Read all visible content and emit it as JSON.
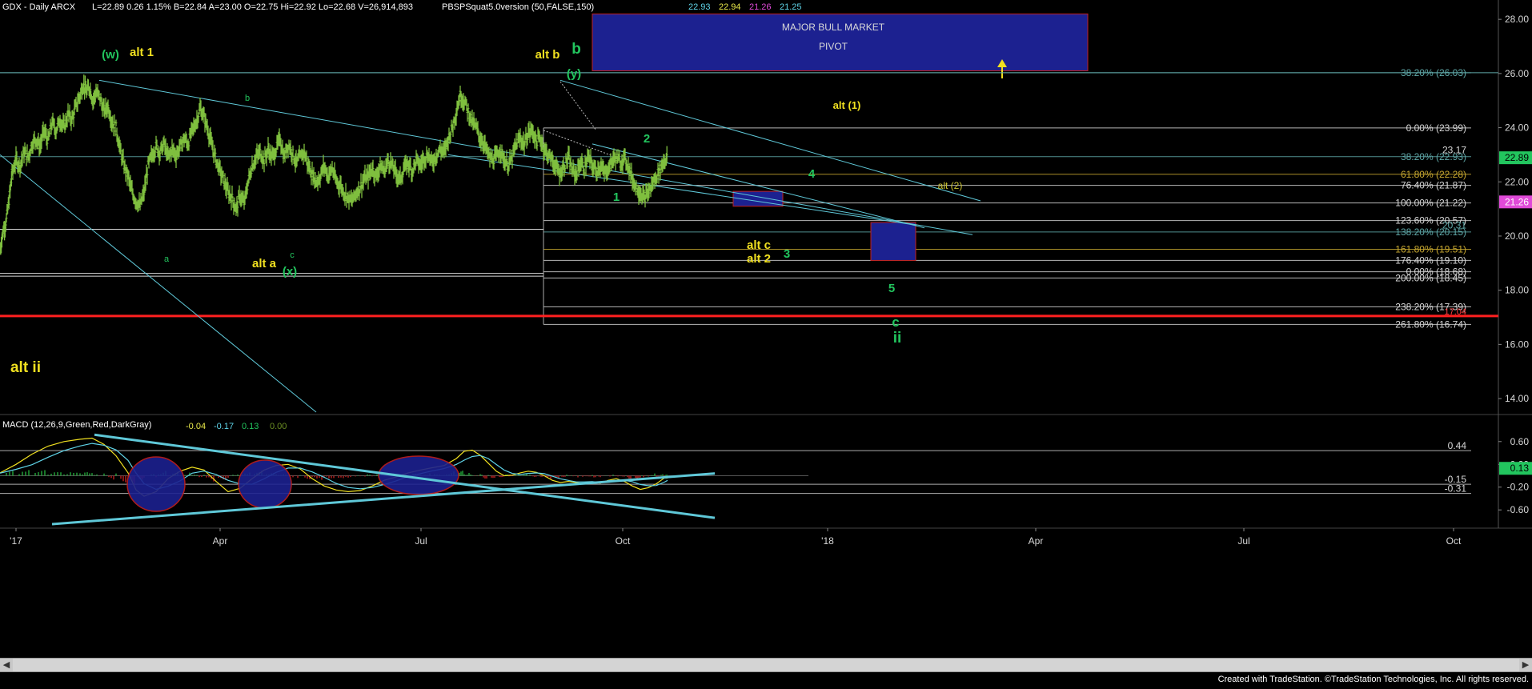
{
  "header": {
    "symbol_line": "GDX - Daily  ARCX",
    "quote": "L=22.89  0.26  1.15%  B=22.84  A=23.00  O=22.75  Hi=22.92  Lo=22.68  V=26,914,893",
    "study_name": "PBSPSquat5.0version (50,FALSE,150)",
    "study_values": [
      {
        "text": "22.93",
        "color": "#5fd4e8"
      },
      {
        "text": "22.94",
        "color": "#e8e84a"
      },
      {
        "text": "21.26",
        "color": "#e04ad8"
      },
      {
        "text": "21.25",
        "color": "#5fd4e8"
      }
    ]
  },
  "macd_header": {
    "name": "MACD (12,26,9,Green,Red,DarkGray)",
    "values": [
      {
        "text": "-0.04",
        "color": "#e8e84a"
      },
      {
        "text": "-0.17",
        "color": "#5fd4e8"
      },
      {
        "text": "0.13",
        "color": "#22c55e"
      },
      {
        "text": "0.00",
        "color": "#6b8e23"
      }
    ]
  },
  "credit": "Created with TradeStation. ©TradeStation Technologies, Inc. All rights reserved.",
  "chart_data": {
    "type": "line",
    "price_axis": {
      "ticks": [
        "28.00",
        "26.00",
        "24.00",
        "22.00",
        "20.00",
        "18.00",
        "16.00",
        "14.00"
      ],
      "ylim": [
        13.5,
        28.3
      ]
    },
    "macd_axis": {
      "ticks": [
        "0.60",
        "0.20",
        "-0.20",
        "-0.60"
      ],
      "ylim": [
        -0.85,
        0.85
      ]
    },
    "x_ticks": [
      "'17",
      "Apr",
      "Jul",
      "Oct",
      "'18",
      "Apr",
      "Jul",
      "Oct"
    ],
    "last_price": {
      "text": "22.89",
      "value": 22.89,
      "color": "#22c55e"
    },
    "last_study": {
      "text": "21.26",
      "value": 21.26,
      "color": "#e04ad8"
    },
    "macd_last": {
      "text": "0.13",
      "value": 0.13,
      "color": "#22c55e"
    },
    "pivot_box": {
      "line1": "MAJOR BULL MARKET",
      "line2": "PIVOT",
      "y_low": 26.1,
      "y_high": 28.2
    },
    "red_support": 17.05,
    "red_support_label": "17.04",
    "fib_levels": [
      {
        "label": "38.20% (26.03)",
        "value": 26.03,
        "color": "#5fa8a8"
      },
      {
        "label": "0.00% (23.99)",
        "value": 23.99,
        "color": "#d8d8d8"
      },
      {
        "label": "38.20% (22.93)",
        "value": 22.93,
        "color": "#5fa8a8"
      },
      {
        "label": "61.80% (22.28)",
        "value": 22.28,
        "color": "#c8a830"
      },
      {
        "label": "76.40% (21.87)",
        "value": 21.87,
        "color": "#d8d8d8"
      },
      {
        "label": "100.00% (21.22)",
        "value": 21.22,
        "color": "#d8d8d8"
      },
      {
        "label": "123.60% (20.57)",
        "value": 20.57,
        "color": "#d8d8d8"
      },
      {
        "label": "138.20% (20.15)",
        "value": 20.15,
        "color": "#5fa8a8"
      },
      {
        "label": "161.80% (19.51)",
        "value": 19.51,
        "color": "#c8a830"
      },
      {
        "label": "176.40% (19.10)",
        "value": 19.1,
        "color": "#d8d8d8"
      },
      {
        "label": "0.00% (18.68)",
        "value": 18.68,
        "color": "#d8d8d8"
      },
      {
        "label": "200.00% (18.45)",
        "value": 18.45,
        "color": "#d8d8d8"
      },
      {
        "label": "238.20% (17.39)",
        "value": 17.39,
        "color": "#d8d8d8"
      },
      {
        "label": "261.80% (16.74)",
        "value": 16.74,
        "color": "#d8d8d8"
      }
    ],
    "extra_labels": [
      {
        "text": "23.17",
        "value": 23.17,
        "color": "#d8d8d8"
      },
      {
        "text": "20.31",
        "value": 20.4,
        "color": "#5fa8a8"
      }
    ],
    "macd_levels": [
      {
        "label": "0.44",
        "value": 0.44
      },
      {
        "label": "-0.15",
        "value": -0.15
      },
      {
        "label": "-0.31",
        "value": -0.31
      }
    ],
    "wave_labels": [
      {
        "text": "(w)",
        "color": "#22c55e",
        "size": 15,
        "bold": true
      },
      {
        "text": "alt 1",
        "color": "#f0e020",
        "size": 15,
        "bold": true
      },
      {
        "text": "b",
        "color": "#22c55e",
        "size": 11,
        "bold": false
      },
      {
        "text": "a",
        "color": "#22c55e",
        "size": 11,
        "bold": false
      },
      {
        "text": "c",
        "color": "#22c55e",
        "size": 11,
        "bold": false
      },
      {
        "text": "alt a",
        "color": "#f0e020",
        "size": 15,
        "bold": true
      },
      {
        "text": "(x)",
        "color": "#22c55e",
        "size": 15,
        "bold": true
      },
      {
        "text": "alt b",
        "color": "#f0e020",
        "size": 15,
        "bold": true
      },
      {
        "text": "b",
        "color": "#22c55e",
        "size": 19,
        "bold": true
      },
      {
        "text": "(y)",
        "color": "#22c55e",
        "size": 15,
        "bold": true
      },
      {
        "text": "alt (1)",
        "color": "#f0e020",
        "size": 13,
        "bold": true
      },
      {
        "text": "2",
        "color": "#22c55e",
        "size": 15,
        "bold": true
      },
      {
        "text": "1",
        "color": "#22c55e",
        "size": 15,
        "bold": true
      },
      {
        "text": "4",
        "color": "#22c55e",
        "size": 15,
        "bold": true
      },
      {
        "text": "3",
        "color": "#22c55e",
        "size": 15,
        "bold": true
      },
      {
        "text": "alt c",
        "color": "#f0e020",
        "size": 15,
        "bold": true
      },
      {
        "text": "alt 2",
        "color": "#f0e020",
        "size": 15,
        "bold": true
      },
      {
        "text": "alt (2)",
        "color": "#c8c030",
        "size": 12,
        "bold": false
      },
      {
        "text": "5",
        "color": "#22c55e",
        "size": 15,
        "bold": true
      },
      {
        "text": "c",
        "color": "#22c55e",
        "size": 17,
        "bold": true
      },
      {
        "text": "ii",
        "color": "#22c55e",
        "size": 19,
        "bold": true
      },
      {
        "text": "alt ii",
        "color": "#f0e020",
        "size": 19,
        "bold": true
      }
    ],
    "price_series": [
      [
        0,
        19.5
      ],
      [
        4,
        20.2
      ],
      [
        8,
        20.6
      ],
      [
        12,
        21.5
      ],
      [
        15,
        22.3
      ],
      [
        20,
        22.8
      ],
      [
        25,
        22.6
      ],
      [
        30,
        23.1
      ],
      [
        35,
        22.9
      ],
      [
        40,
        23.4
      ],
      [
        45,
        23.6
      ],
      [
        50,
        23.3
      ],
      [
        55,
        23.9
      ],
      [
        60,
        23.5
      ],
      [
        65,
        24.2
      ],
      [
        70,
        23.9
      ],
      [
        75,
        24.3
      ],
      [
        80,
        24.0
      ],
      [
        85,
        24.5
      ],
      [
        90,
        24.3
      ],
      [
        95,
        24.8
      ],
      [
        100,
        25.2
      ],
      [
        104,
        25.6
      ],
      [
        108,
        25.3
      ],
      [
        112,
        25.5
      ],
      [
        116,
        25.0
      ],
      [
        120,
        25.3
      ],
      [
        125,
        25.1
      ],
      [
        130,
        24.6
      ],
      [
        135,
        24.8
      ],
      [
        140,
        24.2
      ],
      [
        145,
        24.0
      ],
      [
        150,
        23.2
      ],
      [
        155,
        22.6
      ],
      [
        160,
        22.2
      ],
      [
        165,
        21.6
      ],
      [
        170,
        21.3
      ],
      [
        175,
        21.1
      ],
      [
        180,
        21.6
      ],
      [
        185,
        22.6
      ],
      [
        190,
        23.0
      ],
      [
        195,
        23.3
      ],
      [
        200,
        23.1
      ],
      [
        205,
        23.4
      ],
      [
        210,
        22.9
      ],
      [
        215,
        23.2
      ],
      [
        220,
        23.0
      ],
      [
        225,
        23.3
      ],
      [
        230,
        23.6
      ],
      [
        235,
        23.4
      ],
      [
        240,
        23.9
      ],
      [
        245,
        24.2
      ],
      [
        250,
        24.7
      ],
      [
        255,
        24.4
      ],
      [
        260,
        23.9
      ],
      [
        265,
        23.3
      ],
      [
        270,
        22.8
      ],
      [
        275,
        22.4
      ],
      [
        280,
        22.0
      ],
      [
        285,
        21.6
      ],
      [
        290,
        21.4
      ],
      [
        295,
        21.0
      ],
      [
        300,
        21.5
      ],
      [
        305,
        21.2
      ],
      [
        310,
        22.0
      ],
      [
        315,
        22.6
      ],
      [
        320,
        22.9
      ],
      [
        325,
        23.1
      ],
      [
        330,
        22.8
      ],
      [
        335,
        23.2
      ],
      [
        340,
        22.9
      ],
      [
        345,
        23.2
      ],
      [
        350,
        23.6
      ],
      [
        355,
        22.9
      ],
      [
        360,
        23.4
      ],
      [
        365,
        23.1
      ],
      [
        370,
        22.7
      ],
      [
        375,
        22.9
      ],
      [
        380,
        23.1
      ],
      [
        385,
        22.6
      ],
      [
        390,
        22.3
      ],
      [
        395,
        22.0
      ],
      [
        400,
        22.2
      ],
      [
        405,
        22.6
      ],
      [
        410,
        22.2
      ],
      [
        415,
        22.5
      ],
      [
        420,
        22.0
      ],
      [
        425,
        21.9
      ],
      [
        430,
        21.6
      ],
      [
        435,
        21.4
      ],
      [
        440,
        21.3
      ],
      [
        445,
        21.6
      ],
      [
        450,
        21.8
      ],
      [
        455,
        22.1
      ],
      [
        460,
        22.2
      ],
      [
        465,
        22.5
      ],
      [
        470,
        22.2
      ],
      [
        475,
        22.6
      ],
      [
        480,
        22.4
      ],
      [
        485,
        22.8
      ],
      [
        490,
        22.6
      ],
      [
        495,
        22.3
      ],
      [
        500,
        22.1
      ],
      [
        505,
        22.5
      ],
      [
        510,
        22.7
      ],
      [
        515,
        22.4
      ],
      [
        520,
        22.8
      ],
      [
        525,
        22.6
      ],
      [
        530,
        22.9
      ],
      [
        535,
        23.0
      ],
      [
        540,
        22.7
      ],
      [
        545,
        23.0
      ],
      [
        550,
        23.2
      ],
      [
        555,
        23.1
      ],
      [
        560,
        23.6
      ],
      [
        565,
        24.0
      ],
      [
        570,
        24.6
      ],
      [
        575,
        25.2
      ],
      [
        580,
        25.0
      ],
      [
        585,
        24.6
      ],
      [
        590,
        24.2
      ],
      [
        595,
        24.0
      ],
      [
        600,
        23.6
      ],
      [
        605,
        23.4
      ],
      [
        610,
        23.0
      ],
      [
        615,
        22.8
      ],
      [
        620,
        22.9
      ],
      [
        625,
        23.2
      ],
      [
        630,
        22.8
      ],
      [
        635,
        22.6
      ],
      [
        640,
        22.9
      ],
      [
        645,
        23.4
      ],
      [
        650,
        23.6
      ],
      [
        655,
        23.4
      ],
      [
        660,
        23.8
      ],
      [
        665,
        23.9
      ],
      [
        670,
        23.5
      ],
      [
        675,
        23.6
      ],
      [
        680,
        23.2
      ],
      [
        685,
        23.0
      ],
      [
        690,
        22.8
      ],
      [
        695,
        22.5
      ],
      [
        700,
        22.3
      ],
      [
        705,
        22.6
      ],
      [
        710,
        22.9
      ],
      [
        715,
        22.4
      ],
      [
        720,
        22.3
      ],
      [
        725,
        22.7
      ],
      [
        730,
        22.5
      ],
      [
        735,
        22.9
      ],
      [
        740,
        22.6
      ],
      [
        745,
        22.4
      ],
      [
        750,
        22.6
      ],
      [
        755,
        22.3
      ],
      [
        760,
        22.5
      ],
      [
        765,
        22.8
      ],
      [
        770,
        22.9
      ],
      [
        775,
        22.7
      ],
      [
        780,
        22.9
      ],
      [
        785,
        22.6
      ],
      [
        790,
        22.1
      ],
      [
        795,
        21.8
      ],
      [
        800,
        21.6
      ],
      [
        805,
        21.4
      ],
      [
        810,
        21.6
      ],
      [
        815,
        21.9
      ],
      [
        820,
        22.2
      ],
      [
        825,
        22.5
      ],
      [
        830,
        22.8
      ],
      [
        834,
        22.89
      ]
    ],
    "macd_series": [
      [
        0,
        0.05
      ],
      [
        20,
        0.2
      ],
      [
        40,
        0.38
      ],
      [
        60,
        0.52
      ],
      [
        80,
        0.6
      ],
      [
        100,
        0.64
      ],
      [
        115,
        0.66
      ],
      [
        130,
        0.55
      ],
      [
        145,
        0.35
      ],
      [
        160,
        0.05
      ],
      [
        170,
        -0.25
      ],
      [
        180,
        -0.36
      ],
      [
        195,
        -0.28
      ],
      [
        210,
        -0.05
      ],
      [
        225,
        0.08
      ],
      [
        240,
        0.15
      ],
      [
        255,
        0.1
      ],
      [
        270,
        -0.1
      ],
      [
        285,
        -0.28
      ],
      [
        300,
        -0.22
      ],
      [
        315,
        -0.05
      ],
      [
        330,
        0.1
      ],
      [
        345,
        0.18
      ],
      [
        360,
        0.2
      ],
      [
        375,
        0.12
      ],
      [
        390,
        -0.05
      ],
      [
        405,
        -0.18
      ],
      [
        420,
        -0.25
      ],
      [
        435,
        -0.28
      ],
      [
        450,
        -0.26
      ],
      [
        465,
        -0.18
      ],
      [
        480,
        -0.08
      ],
      [
        495,
        -0.02
      ],
      [
        510,
        0.05
      ],
      [
        525,
        0.1
      ],
      [
        540,
        0.14
      ],
      [
        555,
        0.18
      ],
      [
        570,
        0.3
      ],
      [
        580,
        0.43
      ],
      [
        590,
        0.45
      ],
      [
        600,
        0.36
      ],
      [
        610,
        0.22
      ],
      [
        620,
        0.08
      ],
      [
        630,
        0.0
      ],
      [
        640,
        0.01
      ],
      [
        650,
        0.05
      ],
      [
        660,
        0.08
      ],
      [
        670,
        0.06
      ],
      [
        680,
        0.0
      ],
      [
        690,
        -0.08
      ],
      [
        700,
        -0.12
      ],
      [
        710,
        -0.1
      ],
      [
        720,
        -0.12
      ],
      [
        730,
        -0.14
      ],
      [
        740,
        -0.11
      ],
      [
        750,
        -0.13
      ],
      [
        760,
        -0.08
      ],
      [
        770,
        -0.05
      ],
      [
        780,
        -0.1
      ],
      [
        790,
        -0.18
      ],
      [
        800,
        -0.24
      ],
      [
        810,
        -0.21
      ],
      [
        820,
        -0.14
      ],
      [
        830,
        -0.04
      ],
      [
        834,
        -0.04
      ]
    ]
  }
}
